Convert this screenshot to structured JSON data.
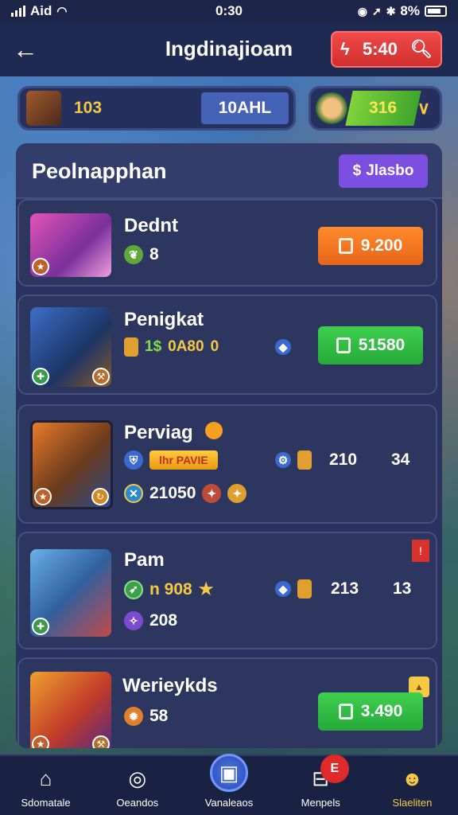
{
  "status_bar": {
    "carrier": "Aid",
    "time": "0:30",
    "battery": "8%"
  },
  "header": {
    "title": "Ingdinajioam",
    "energy_value": "5:40"
  },
  "resources": {
    "left_value": "103",
    "left_pill": "10AHL",
    "right_value": "316"
  },
  "panel": {
    "title": "Peolnapphan",
    "badge": "Jlasbo"
  },
  "cards": [
    {
      "name": "Dednt",
      "stat1": "8",
      "button": "9.200"
    },
    {
      "name": "Penigkat",
      "stat1": "1$",
      "stat1b": "0A80",
      "stat1c": "0",
      "button": "51580"
    },
    {
      "name": "Perviag",
      "pill": "lhr PAVIE",
      "stat2": "210",
      "stat3": "34",
      "stat4": "21050"
    },
    {
      "name": "Pam",
      "stat1": "n 908",
      "stat2": "213",
      "stat3": "13",
      "stat4": "208"
    },
    {
      "name": "Werieykds",
      "stat1": "58",
      "button": "3.490"
    }
  ],
  "bottom_nav": [
    {
      "label": "Sdomatale"
    },
    {
      "label": "Oeandos"
    },
    {
      "label": "Vanaleaos"
    },
    {
      "label": "Menpels",
      "badge": "E"
    },
    {
      "label": "Slaeliten"
    }
  ]
}
